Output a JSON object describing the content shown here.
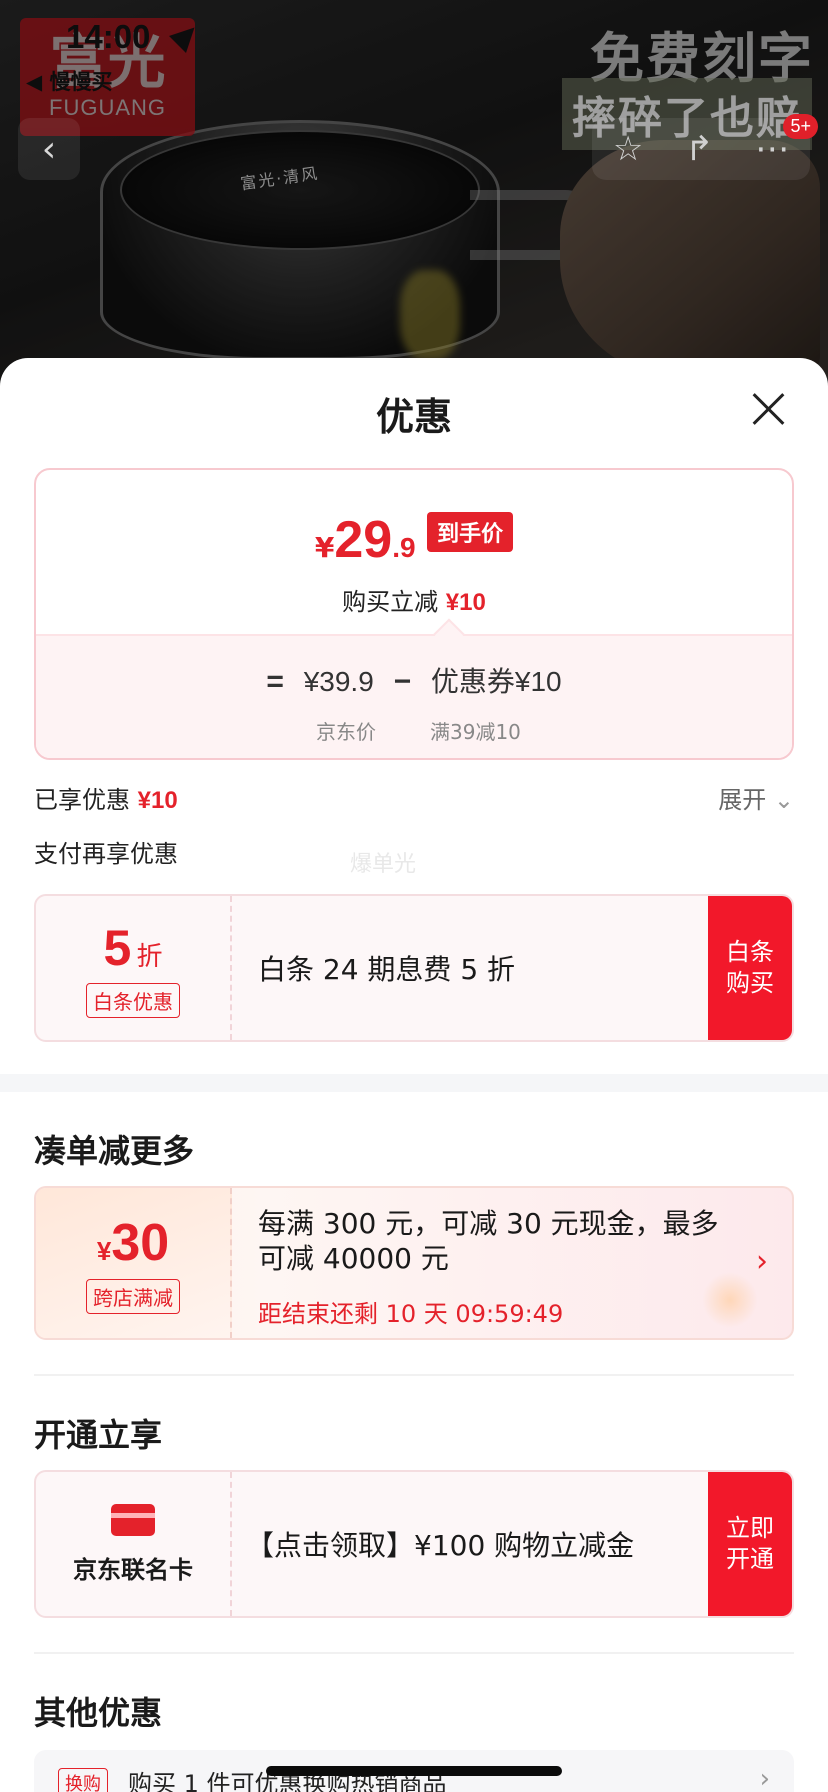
{
  "status_bar": {
    "time": "14:00",
    "back_app": "◀ 慢慢买"
  },
  "background": {
    "brand_cn": "富光",
    "brand_en": "FUGUANG",
    "promo_line1": "免费刻字",
    "promo_line2": "摔碎了也赔",
    "mug_text": "富光·清风",
    "cart_badge": "5+"
  },
  "sheet": {
    "title": "优惠",
    "final_price": {
      "yen": "¥",
      "int": "29",
      "dec": ".9",
      "tag": "到手价"
    },
    "instant_cut": {
      "label": "购买立减",
      "amount": "¥10"
    },
    "formula": {
      "eq": "=",
      "jd_price": "¥39.9",
      "minus": "−",
      "coupon": "优惠券¥10",
      "jd_price_label": "京东价",
      "coupon_label": "满39减10"
    },
    "enjoyed": {
      "label": "已享优惠",
      "amount": "¥10"
    },
    "expand_label": "展开",
    "pay_more_label": "支付再享优惠",
    "watermark": "爆单光",
    "baitiao": {
      "discount_num": "5",
      "discount_unit": "折",
      "tag": "白条优惠",
      "desc": "白条 24 期息费 5 折",
      "action_line1": "白条",
      "action_line2": "购买"
    },
    "section_more": "凑单减更多",
    "fullcut": {
      "yen": "¥",
      "amount": "30",
      "tag": "跨店满减",
      "text": "每满 300 元，可减 30 元现金，最多可减 40000 元",
      "countdown": "距结束还剩 10 天 09:59:49"
    },
    "section_open": "开通立享",
    "cobrand": {
      "label": "京东联名卡",
      "desc": "【点击领取】¥100 购物立减金",
      "action_line1": "立即",
      "action_line2": "开通"
    },
    "section_other": "其他优惠",
    "other": {
      "tag": "换购",
      "text": "购买 1 件可优惠换购热销商品"
    }
  },
  "colors": {
    "accent_red": "#e4222b",
    "action_red": "#f2182a"
  }
}
